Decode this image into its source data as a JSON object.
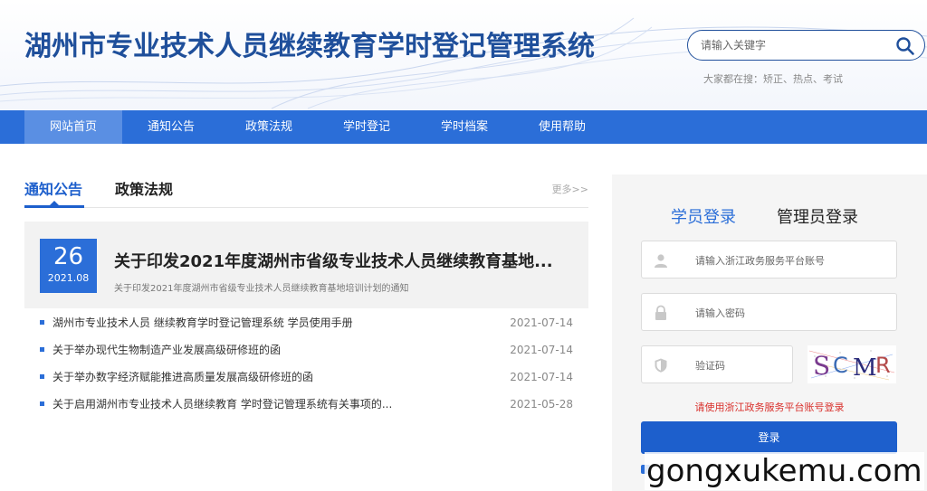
{
  "header": {
    "site_title": "湖州市专业技术人员继续教育学时登记管理系统",
    "search_placeholder": "请输入关键字",
    "hot_search": "大家都在搜：矫正、热点、考试"
  },
  "nav": {
    "items": [
      {
        "label": "网站首页",
        "active": true
      },
      {
        "label": "通知公告",
        "active": false
      },
      {
        "label": "政策法规",
        "active": false
      },
      {
        "label": "学时登记",
        "active": false
      },
      {
        "label": "学时档案",
        "active": false
      },
      {
        "label": "使用帮助",
        "active": false
      }
    ]
  },
  "news": {
    "tabs": [
      {
        "label": "通知公告",
        "active": true
      },
      {
        "label": "政策法规",
        "active": false
      }
    ],
    "more": "更多>>",
    "featured": {
      "day": "26",
      "year_month": "2021.08",
      "title": "关于印发2021年度湖州市省级专业技术人员继续教育基地...",
      "subtitle": "关于印发2021年度湖州市省级专业技术人员继续教育基地培训计划的通知"
    },
    "items": [
      {
        "title": "湖州市专业技术人员 继续教育学时登记管理系统 学员使用手册",
        "date": "2021-07-14"
      },
      {
        "title": "关于举办现代生物制造产业发展高级研修班的函",
        "date": "2021-07-14"
      },
      {
        "title": "关于举办数字经济赋能推进高质量发展高级研修班的函",
        "date": "2021-07-14"
      },
      {
        "title": "关于启用湖州市专业技术人员继续教育 学时登记管理系统有关事项的...",
        "date": "2021-05-28"
      }
    ]
  },
  "login": {
    "tabs": [
      {
        "label": "学员登录",
        "active": true
      },
      {
        "label": "管理员登录",
        "active": false
      }
    ],
    "account_placeholder": "请输入浙江政务服务平台账号",
    "password_placeholder": "请输入密码",
    "captcha_placeholder": "验证码",
    "captcha_text": "SCMR",
    "hint": "请使用浙江政务服务平台账号登录",
    "submit_label": "登录"
  },
  "watermark": "gongxukemu.com",
  "colors": {
    "brand_blue": "#2b6ed8",
    "title_blue": "#1f4f9b",
    "hint_red": "#d9302c"
  }
}
